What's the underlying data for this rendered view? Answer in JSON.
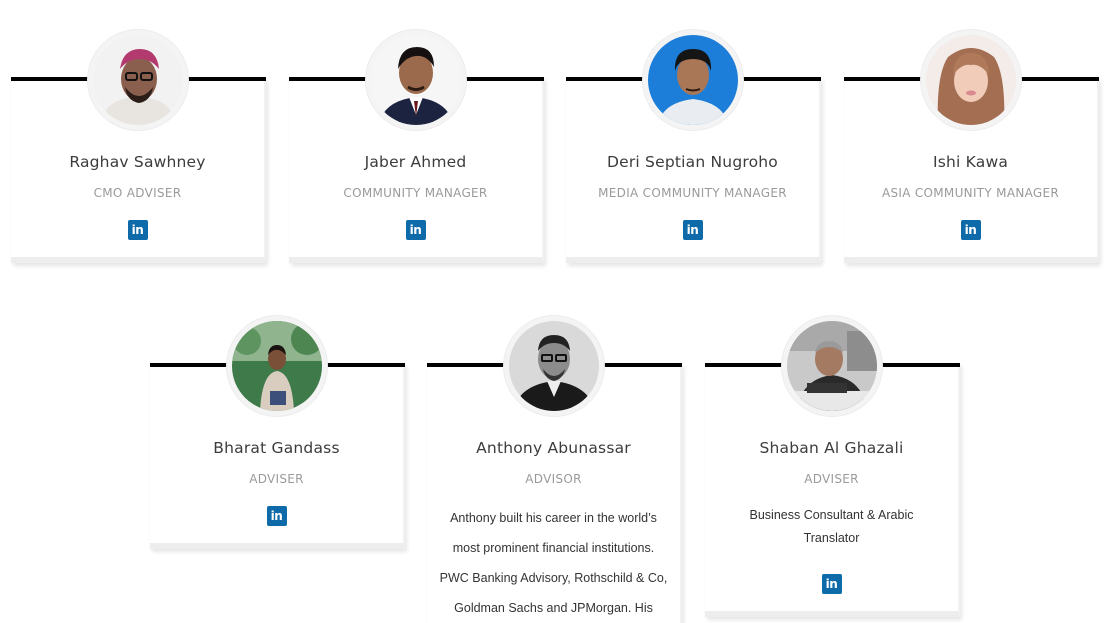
{
  "team": [
    {
      "name": "Raghav Sawhney",
      "role": "CMO ADVISER",
      "social_icon": "in"
    },
    {
      "name": "Jaber Ahmed",
      "role": "COMMUNITY MANAGER",
      "social_icon": "in"
    },
    {
      "name": "Deri Septian Nugroho",
      "role": "MEDIA COMMUNITY MANAGER",
      "social_icon": "in"
    },
    {
      "name": "Ishi Kawa",
      "role": "ASIA COMMUNITY MANAGER",
      "social_icon": "in"
    },
    {
      "name": "Bharat Gandass",
      "role": "ADVISER",
      "social_icon": "in"
    },
    {
      "name": "Anthony Abunassar",
      "role": "ADVISOR",
      "bio": "Anthony built his career in the world’s most prominent financial institutions. PWC Banking Advisory, Rothschild & Co, Goldman Sachs and JPMorgan. His"
    },
    {
      "name": "Shaban Al Ghazali",
      "role": "ADVISER",
      "bio": "Business Consultant & Arabic Translator",
      "social_icon": "in"
    }
  ],
  "colors": {
    "linkedin": "#0e6aa8",
    "name_text": "#3c3c3c",
    "role_text": "#9a9a9a",
    "top_bar": "#000000"
  },
  "icons": {
    "social": "linkedin-icon"
  }
}
